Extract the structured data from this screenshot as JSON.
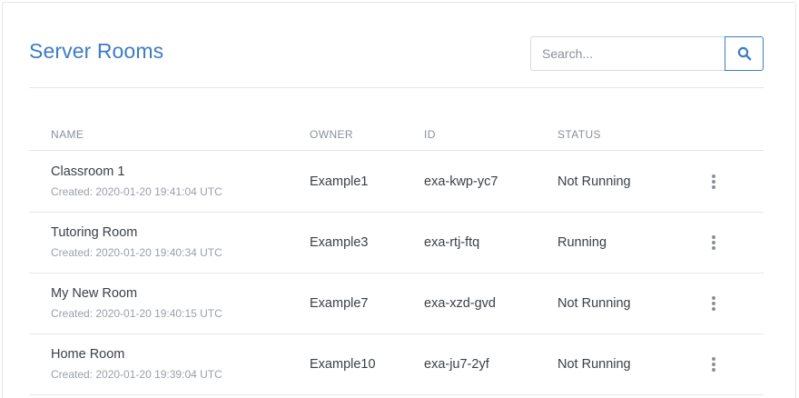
{
  "header": {
    "title": "Server Rooms"
  },
  "search": {
    "placeholder": "Search...",
    "value": "",
    "button_icon": "search-icon",
    "accent_color": "#3d7cc4"
  },
  "table": {
    "columns": {
      "name": "NAME",
      "owner": "OWNER",
      "id": "ID",
      "status": "STATUS"
    },
    "rows": [
      {
        "name": "Classroom 1",
        "created": "Created: 2020-01-20 19:41:04 UTC",
        "owner": "Example1",
        "id": "exa-kwp-yc7",
        "status": "Not Running",
        "menu_icon": "more-vertical-icon"
      },
      {
        "name": "Tutoring Room",
        "created": "Created: 2020-01-20 19:40:34 UTC",
        "owner": "Example3",
        "id": "exa-rtj-ftq",
        "status": "Running",
        "menu_icon": "more-vertical-icon"
      },
      {
        "name": "My New Room",
        "created": "Created: 2020-01-20 19:40:15 UTC",
        "owner": "Example7",
        "id": "exa-xzd-gvd",
        "status": "Not Running",
        "menu_icon": "more-vertical-icon"
      },
      {
        "name": "Home Room",
        "created": "Created: 2020-01-20 19:39:04 UTC",
        "owner": "Example10",
        "id": "exa-ju7-2yf",
        "status": "Not Running",
        "menu_icon": "more-vertical-icon"
      }
    ]
  }
}
